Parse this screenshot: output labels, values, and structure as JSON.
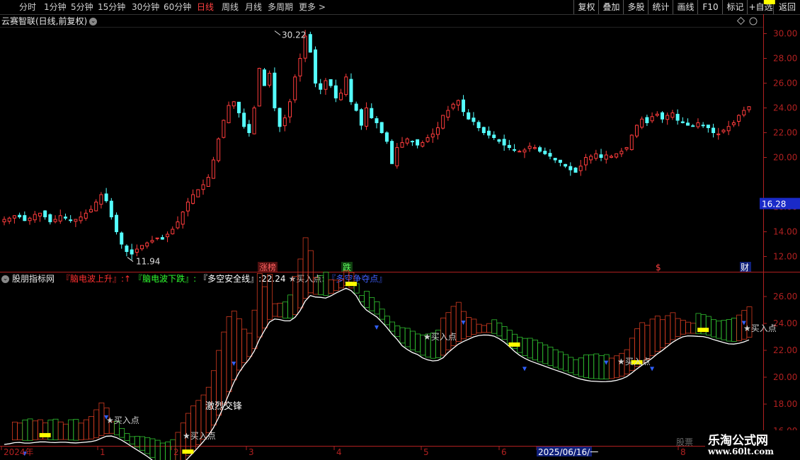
{
  "toolbar": {
    "periods": [
      "分时",
      "1分钟",
      "5分钟",
      "15分钟",
      "30分钟",
      "60分钟",
      "日线",
      "周线",
      "月线",
      "多周期",
      "更多 >"
    ],
    "active": "日线",
    "right_buttons": [
      "复权",
      "叠加",
      "多股",
      "统计",
      "画线",
      "F10",
      "标记",
      "+自选",
      "返回"
    ]
  },
  "main_chart": {
    "title": "云赛智联(日线,前复权)",
    "title_icon": "chevron-down-icon",
    "price_axis_ticks": [
      "30.00",
      "28.00",
      "26.00",
      "24.00",
      "22.00",
      "20.00",
      "16.00",
      "14.00",
      "12.00"
    ],
    "current_price_label": "16.28",
    "high_label": "30.22",
    "low_label": "11.94",
    "markers": {
      "zhangbang": "涨榜",
      "die": "跌",
      "s": "$",
      "cai": "财"
    }
  },
  "indicator": {
    "title": "股朋指标网",
    "items": [
      {
        "text": "『脑电波上升』:↑",
        "color": "#ff3030"
      },
      {
        "text": "『脑电波下跌』:",
        "color": "#30ff30"
      },
      {
        "text": "『多空安全线』:22.24",
        "color": "#ffffff"
      },
      {
        "text": "★买入点:",
        "color": "#c0c0c0"
      },
      {
        "text": "『多空争夺点』",
        "color": "#4060ff"
      }
    ],
    "axis_ticks": [
      "26.00",
      "24.00",
      "22.00",
      "20.00",
      "18.00",
      "16.00"
    ],
    "buy_label": "★买入点",
    "fight_label": "激烈交锋"
  },
  "time_axis": {
    "labels": [
      "2024年",
      "1",
      "2",
      "3",
      "4",
      "5",
      "6",
      "2025/06/16/一",
      "8"
    ]
  },
  "watermark": {
    "line1": "乐淘公式网",
    "line2": "www.60lt.com",
    "stock_label": "股票"
  },
  "colors": {
    "up": "#ff3c3c",
    "down": "#54ffff",
    "accent": "#ffff00",
    "axis": "#b02020"
  },
  "chart_data": {
    "type": "candlestick",
    "price_range": [
      11.0,
      31.0
    ],
    "high": 30.22,
    "low": 11.94,
    "current": 16.28,
    "close_series": [
      15.0,
      15.1,
      15.3,
      15.2,
      14.9,
      15.1,
      15.4,
      15.5,
      15.2,
      14.8,
      15.0,
      15.3,
      15.1,
      14.9,
      15.0,
      15.2,
      15.5,
      15.8,
      16.4,
      17.0,
      16.5,
      15.2,
      14.0,
      13.0,
      12.4,
      12.2,
      12.6,
      12.9,
      13.1,
      13.3,
      13.5,
      13.4,
      13.8,
      14.2,
      14.8,
      15.6,
      16.4,
      17.0,
      17.4,
      17.8,
      18.4,
      19.8,
      21.5,
      23.0,
      24.2,
      24.5,
      23.6,
      22.5,
      22.0,
      24.0,
      27.2,
      25.8,
      26.8,
      24.0,
      22.5,
      23.2,
      24.5,
      26.5,
      28.0,
      29.8,
      28.5,
      26.0,
      25.5,
      26.2,
      25.8,
      24.8,
      25.2,
      26.5,
      24.5,
      23.8,
      22.6,
      24.0,
      23.2,
      22.8,
      22.0,
      21.3,
      19.5,
      20.8,
      21.2,
      21.5,
      21.3,
      21.0,
      21.2,
      21.6,
      21.9,
      22.4,
      23.4,
      23.8,
      24.3,
      24.6,
      23.7,
      23.1,
      22.9,
      22.4,
      22.0,
      21.8,
      21.6,
      21.3,
      21.0,
      20.8,
      20.6,
      20.5,
      20.6,
      20.9,
      20.8,
      20.5,
      20.3,
      20.1,
      19.8,
      19.6,
      19.3,
      19.0,
      18.8,
      19.3,
      20.0,
      20.1,
      20.3,
      20.0,
      20.2,
      20.1,
      20.3,
      20.5,
      20.8,
      21.8,
      22.6,
      23.1,
      22.8,
      23.3,
      23.5,
      23.1,
      23.4,
      23.6,
      23.0,
      22.8,
      22.6,
      22.5,
      22.8,
      22.6,
      22.4,
      22.0,
      21.9,
      22.2,
      22.5,
      22.8,
      23.4,
      23.8,
      24.1
    ],
    "safety_line": 22.24
  }
}
